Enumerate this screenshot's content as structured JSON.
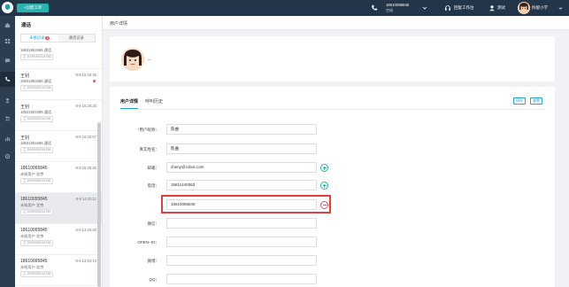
{
  "topbar": {
    "new_order_label": "+创建工单",
    "phone_number": "18610095845",
    "phone_status": "空闲",
    "workspace_label": "回复工作台",
    "test_label": "测试",
    "user_label": "拘留小学",
    "colors": {
      "bar": "#233549",
      "accent": "#29b3ae"
    }
  },
  "nav": {
    "icons": [
      "home-icon",
      "grid-icon",
      "chat-icon",
      "phone-icon",
      "user-icon",
      "users-icon",
      "chart-icon",
      "gear-icon"
    ]
  },
  "convo": {
    "title": "通话",
    "tabs": [
      {
        "label": "未接记录",
        "badge": "2"
      },
      {
        "label": "通话记录"
      }
    ],
    "items": [
      {
        "name": "",
        "time": "",
        "sub": "18631881686 通话",
        "tag": "工 DSRSEE014756"
      },
      {
        "name": "王钊",
        "time": "8-8 15:20:45",
        "sub": "18631881686 通话",
        "tag": "工 DSRSEE014756",
        "dot": true
      },
      {
        "name": "王钊",
        "time": "8-8 15:20:20",
        "sub": "18631881686 通话",
        "tag": "工 DSRSEE014756"
      },
      {
        "name": "王钊",
        "time": "8-8 15:20:57",
        "sub": "18631881686 通话",
        "tag": "工 DSRSEE014756"
      },
      {
        "name": "18610095845",
        "time": "8-8 15:26:25",
        "sub": "未知用户 北京",
        "tag": "工 DSRSEE014756"
      },
      {
        "name": "18610095845",
        "time": "8-8 14:20:11",
        "sub": "未知用户 北京",
        "tag": "工 DSRSEE014756",
        "selected": true
      },
      {
        "name": "18610095845",
        "time": "8-8 14:20:50",
        "sub": "未知用户 北京",
        "tag": "工 DSRSEE014756"
      },
      {
        "name": "18610095845",
        "time": "8-8 13:54:13",
        "sub": "未知用户 北京",
        "tag": "工 DSRSEE014756"
      }
    ]
  },
  "main": {
    "page_title": "用户详情",
    "profile_dash": "--",
    "tabs": [
      {
        "label": "用户详情"
      },
      {
        "label": "呼叫历史"
      }
    ],
    "save_label": "保存",
    "reset_label": "重置",
    "fields": [
      {
        "label": "*用户昵称：",
        "value": "陈曲"
      },
      {
        "label": "真实姓名：",
        "value": "陈曲"
      },
      {
        "label": "邮箱：",
        "value": "zheny@zobot.com"
      },
      {
        "label": "电话：",
        "value": "15811440063"
      },
      {
        "label": "",
        "value": "18610095845"
      },
      {
        "label": "微信：",
        "value": ""
      },
      {
        "label": "OPEN--ID：",
        "value": ""
      },
      {
        "label": "微博：",
        "value": ""
      },
      {
        "label": "QQ：",
        "value": ""
      }
    ]
  }
}
